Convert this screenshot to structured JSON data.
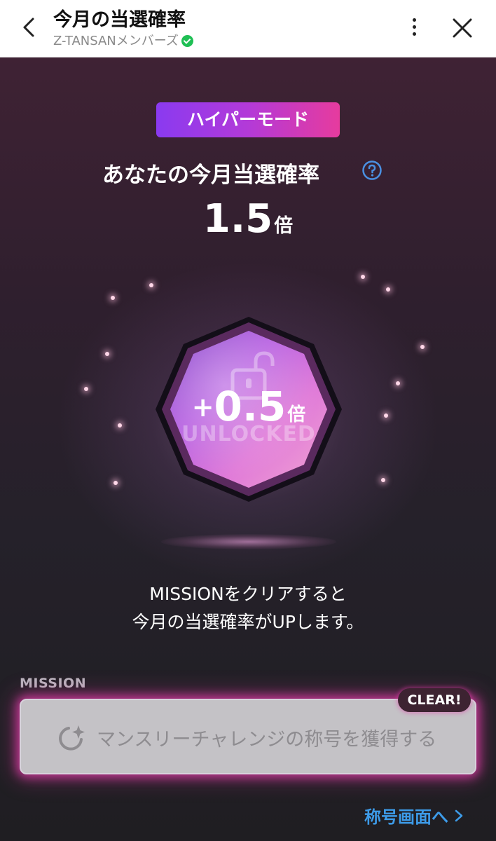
{
  "header": {
    "title": "今月の当選確率",
    "subtitle": "Z-TANSANメンバーズ"
  },
  "main": {
    "mode_badge": "ハイパーモード",
    "probability_label": "あなたの今月当選確率",
    "rate_value": "1.5",
    "rate_unit": "倍",
    "badge": {
      "plus": "+",
      "value": "0.5",
      "unit": "倍",
      "status": "UNLOCKED"
    },
    "description": [
      "MISSIONをクリアすると",
      "今月の当選確率がUPします。"
    ]
  },
  "mission": {
    "heading": "MISSION",
    "status_badge": "CLEAR!",
    "text": "マンスリーチャレンジの称号を獲得する"
  },
  "footer": {
    "link_label": "称号画面へ"
  },
  "colors": {
    "mode_gradient_start": "#8a3af0",
    "mode_gradient_end": "#e63b9e",
    "link": "#3d9be8",
    "mission_glow": "#e43caa",
    "help_icon": "#4a90e2"
  },
  "icons": {
    "back": "chevron-left-icon",
    "more": "more-vertical-icon",
    "close": "close-icon",
    "verified": "verified-icon",
    "help": "help-circle-icon",
    "lock": "unlocked-padlock-icon",
    "mission": "badge-sparkle-icon",
    "link_arrow": "chevron-right-icon"
  }
}
